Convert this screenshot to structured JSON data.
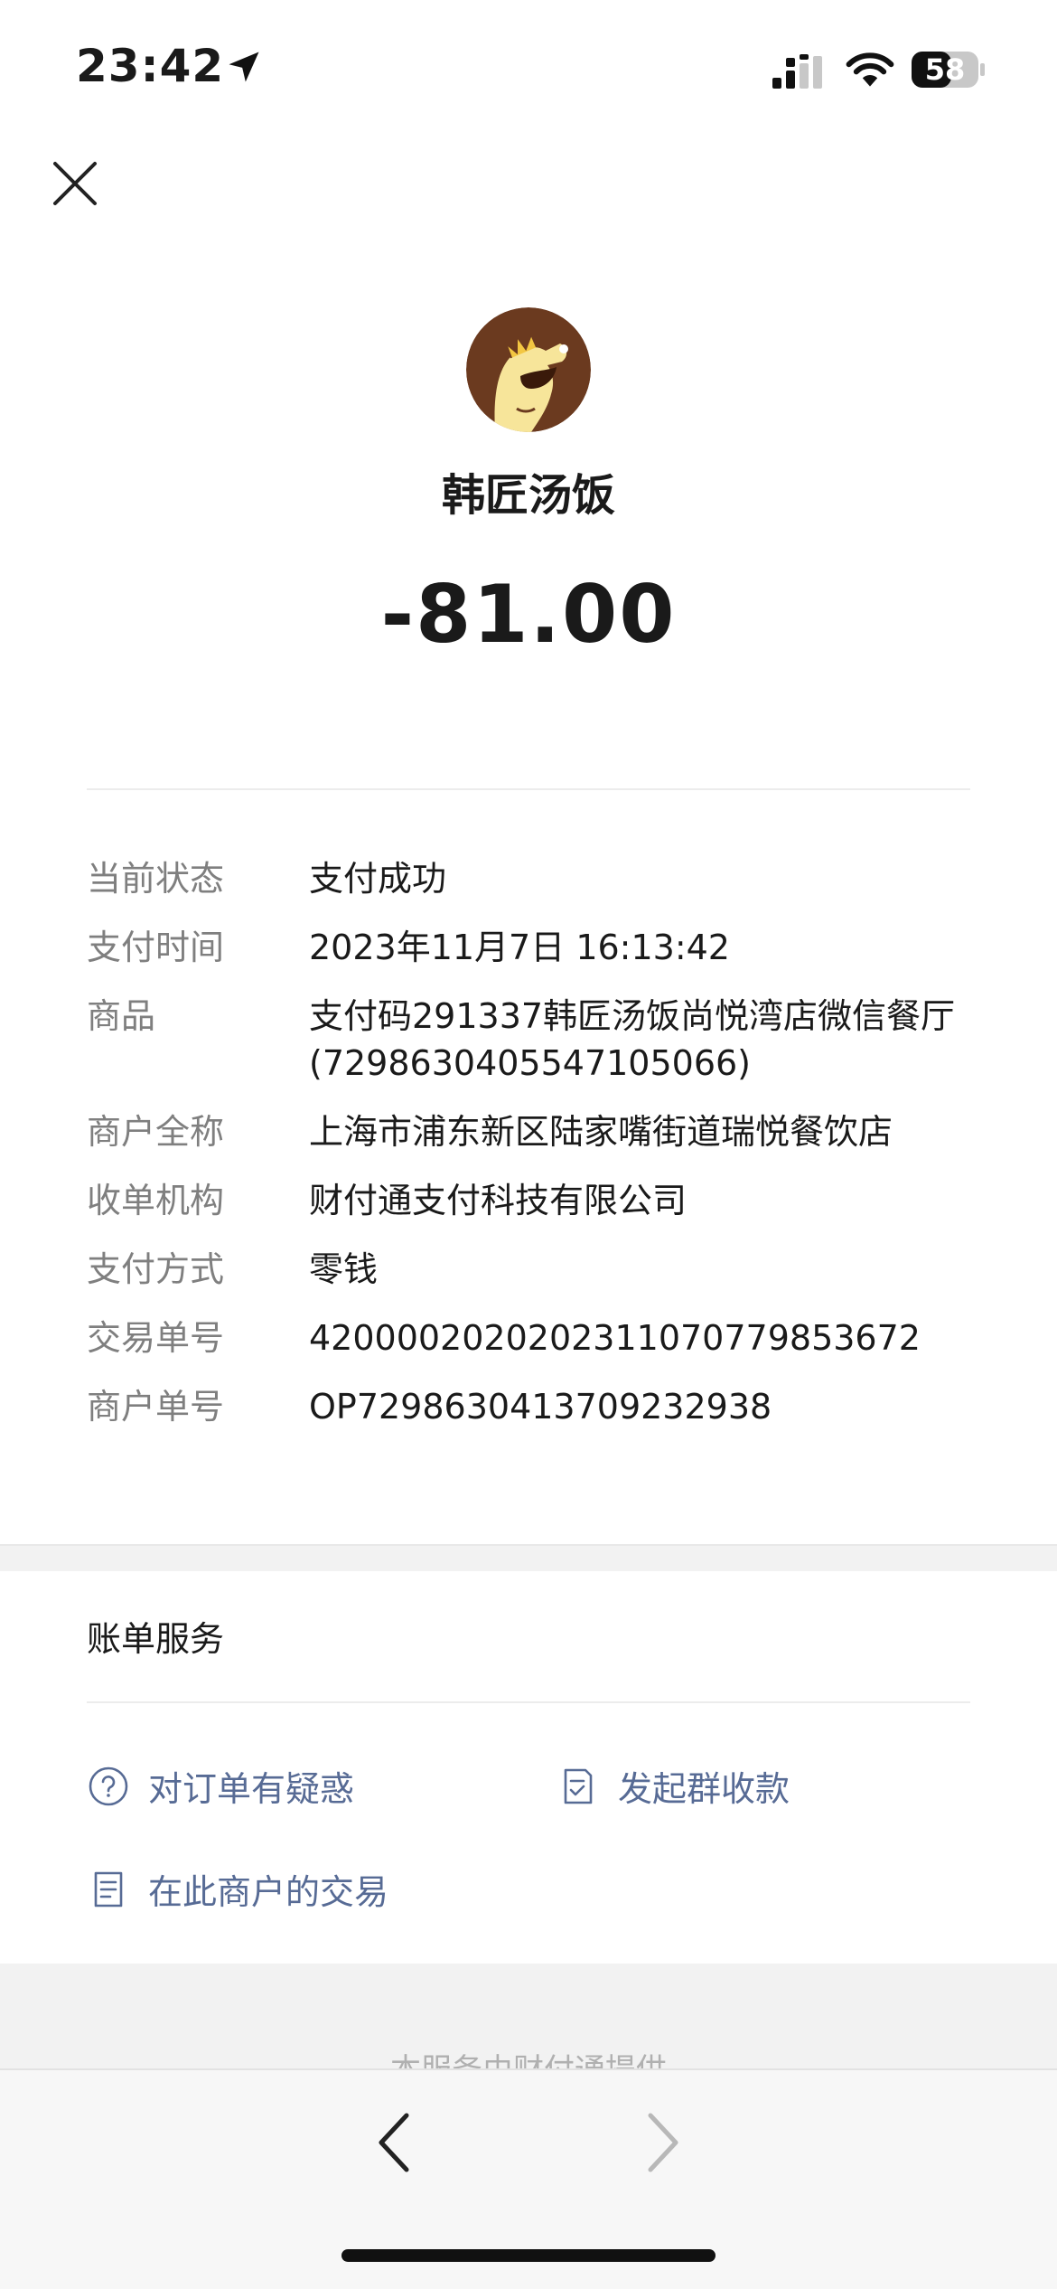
{
  "status_bar": {
    "time": "23:42",
    "battery_level": "58",
    "icons": [
      "location-arrow-icon",
      "signal-icon",
      "wifi-icon",
      "battery-icon"
    ]
  },
  "header": {
    "close_icon": "close-icon",
    "merchant_name": "韩匠汤饭",
    "amount": "-81.00"
  },
  "details": [
    {
      "label": "当前状态",
      "value": "支付成功"
    },
    {
      "label": "支付时间",
      "value": "2023年11月7日 16:13:42"
    },
    {
      "label": "商品",
      "value": "支付码291337韩匠汤饭尚悦湾店微信餐厅(7298630405547105066)"
    },
    {
      "label": "商户全称",
      "value": "上海市浦东新区陆家嘴街道瑞悦餐饮店"
    },
    {
      "label": "收单机构",
      "value": "财付通支付科技有限公司"
    },
    {
      "label": "支付方式",
      "value": "零钱"
    },
    {
      "label": "交易单号",
      "value": "4200002020202311070779853672"
    },
    {
      "label": "商户单号",
      "value": "OP7298630413709232938"
    }
  ],
  "bill_services": {
    "title": "账单服务",
    "items": [
      {
        "label": "对订单有疑惑",
        "icon": "question-circle-icon"
      },
      {
        "label": "发起群收款",
        "icon": "checklist-icon"
      },
      {
        "label": "在此商户的交易",
        "icon": "document-icon"
      }
    ]
  },
  "footer": {
    "note": "本服务由财付通提供"
  },
  "colors": {
    "link": "#576b95",
    "label_gray": "#7f7f7f",
    "background_gray": "#f2f2f2"
  }
}
